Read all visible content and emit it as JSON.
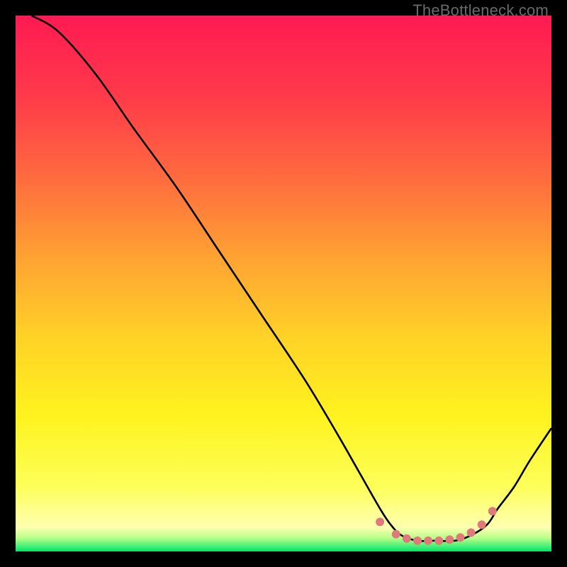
{
  "watermark": "TheBottleneck.com",
  "chart_data": {
    "type": "line",
    "title": "",
    "xlabel": "",
    "ylabel": "",
    "xlim": [
      0,
      100
    ],
    "ylim": [
      0,
      100
    ],
    "gradient_stops": [
      {
        "offset": 0.0,
        "color": "#ff1a52"
      },
      {
        "offset": 0.15,
        "color": "#ff3a4a"
      },
      {
        "offset": 0.3,
        "color": "#ff6a3f"
      },
      {
        "offset": 0.45,
        "color": "#ffa233"
      },
      {
        "offset": 0.6,
        "color": "#ffd227"
      },
      {
        "offset": 0.75,
        "color": "#fff31f"
      },
      {
        "offset": 0.88,
        "color": "#fdff5a"
      },
      {
        "offset": 0.955,
        "color": "#ffffb0"
      },
      {
        "offset": 0.975,
        "color": "#b8ff8a"
      },
      {
        "offset": 1.0,
        "color": "#00e56a"
      }
    ],
    "curve": {
      "x": [
        3,
        8,
        15,
        22,
        30,
        38,
        46,
        54,
        60,
        64,
        68,
        70,
        72,
        75,
        78,
        82,
        85,
        88,
        90,
        93,
        96,
        100
      ],
      "y": [
        100,
        97,
        89,
        79,
        68,
        56,
        44,
        32,
        22,
        15,
        8,
        5,
        3,
        2,
        2,
        2,
        3,
        5,
        8,
        12,
        17,
        23
      ]
    },
    "dots": {
      "x": [
        68,
        71,
        73,
        75,
        77,
        79,
        81,
        83,
        85,
        87,
        89
      ],
      "y": [
        5.5,
        3.2,
        2.4,
        2.0,
        2.0,
        2.0,
        2.2,
        2.6,
        3.5,
        5.0,
        7.5
      ],
      "color": "#e07a7a",
      "radius": 6
    }
  }
}
